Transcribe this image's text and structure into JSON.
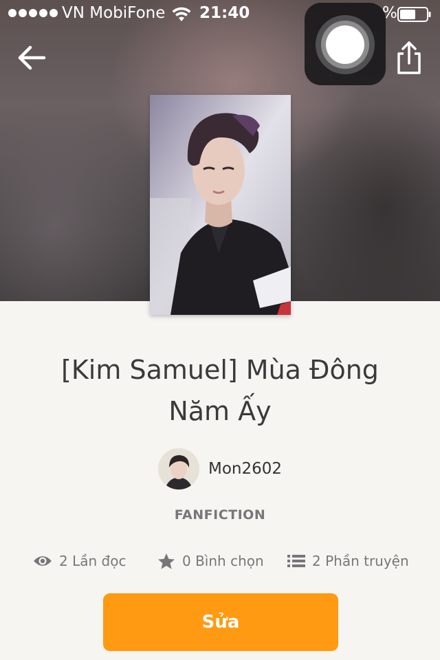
{
  "status_bar": {
    "carrier": "VN MobiFone",
    "time": "21:40",
    "battery_percent": "%"
  },
  "nav": {
    "back_icon": "arrow-left-icon",
    "share_icon": "share-icon",
    "assistive_touch_icon": "assistive-touch-icon"
  },
  "story": {
    "title": "[Kim Samuel] Mùa Đông Năm Ấy",
    "author": "Mon2602",
    "category": "FANFICTION",
    "stats": {
      "reads": "2 Lần đọc",
      "votes": "0 Bình chọn",
      "parts": "2 Phần truyện"
    },
    "edit_label": "Sửa"
  },
  "colors": {
    "accent": "#ff9a12",
    "background": "#f6f5f2",
    "text_primary": "#3a3a3a",
    "text_secondary": "#777777"
  }
}
